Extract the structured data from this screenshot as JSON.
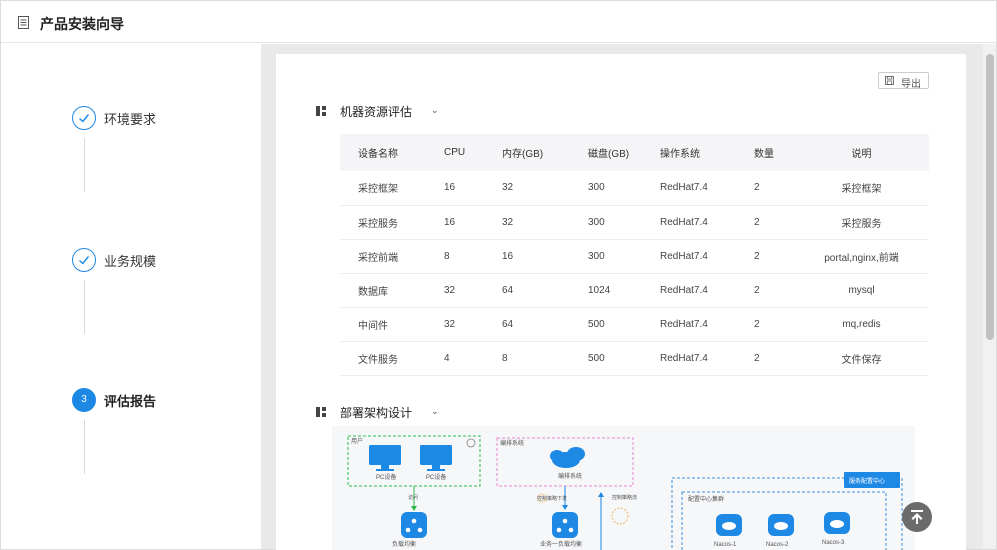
{
  "header": {
    "title": "产品安装向导",
    "icon": "document-icon"
  },
  "steps": [
    {
      "label": "环境要求",
      "status": "done",
      "icon": "check-icon"
    },
    {
      "label": "业务规模",
      "status": "done",
      "icon": "check-icon"
    },
    {
      "label": "评估报告",
      "status": "active",
      "number": "3"
    }
  ],
  "toolbar": {
    "export_label": "导出",
    "export_icon": "save-icon"
  },
  "sections": {
    "resources": {
      "title": "机器资源评估"
    },
    "deployment": {
      "title": "部署架构设计"
    }
  },
  "table": {
    "headers": [
      "设备名称",
      "CPU",
      "内存(GB)",
      "磁盘(GB)",
      "操作系统",
      "数量",
      "说明"
    ],
    "rows": [
      [
        "采控框架",
        "16",
        "32",
        "300",
        "RedHat7.4",
        "2",
        "采控框架"
      ],
      [
        "采控服务",
        "16",
        "32",
        "300",
        "RedHat7.4",
        "2",
        "采控服务"
      ],
      [
        "采控前端",
        "8",
        "16",
        "300",
        "RedHat7.4",
        "2",
        "portal,nginx,前端"
      ],
      [
        "数据库",
        "32",
        "64",
        "1024",
        "RedHat7.4",
        "2",
        "mysql"
      ],
      [
        "中间件",
        "32",
        "64",
        "500",
        "RedHat7.4",
        "2",
        "mq,redis"
      ],
      [
        "文件服务",
        "4",
        "8",
        "500",
        "RedHat7.4",
        "2",
        "文件保存"
      ]
    ]
  },
  "diagram": {
    "groups": {
      "users": "用户",
      "orchestration": "编排系统",
      "config_center": "服务配置中心",
      "monitor_cluster": "配置中心集群"
    },
    "nodes": {
      "pc1": "PC设备",
      "pc2": "PC设备",
      "orchestrator": "编排系统",
      "lb1": "负载均衡",
      "lb2": "业务一负载均衡",
      "nacos1": "Nacos-1",
      "nacos2": "Nacos-2",
      "nacos3": "Nacos-3"
    },
    "edges": {
      "access": "访问",
      "dispatch": "控制策略下发",
      "control": "控制策略流"
    },
    "colors": {
      "accent": "#1e88e5",
      "green": "#2db84d",
      "pink": "#e68ad3",
      "blue_dash": "#3d8fd9"
    }
  },
  "colors": {
    "accent": "#1e88e5",
    "gray_bg": "#e9e9e9"
  }
}
